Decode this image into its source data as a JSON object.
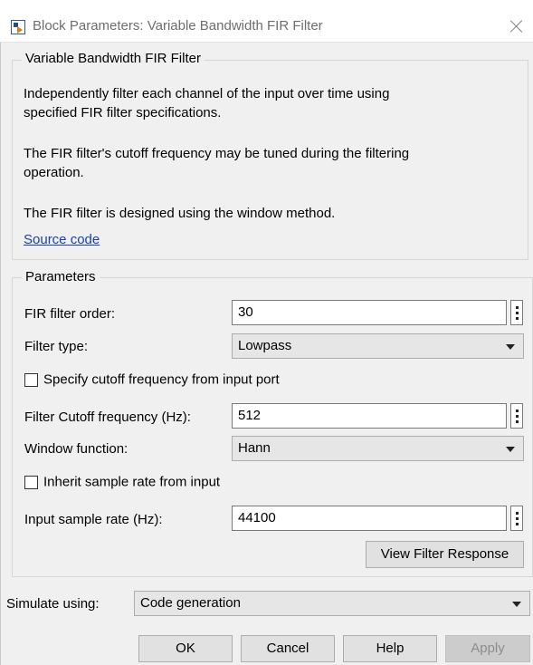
{
  "window": {
    "title": "Block Parameters: Variable Bandwidth FIR Filter",
    "icon": "simulink-block-icon",
    "close_icon": "close-icon"
  },
  "description": {
    "group_title": "Variable Bandwidth FIR Filter",
    "line1": "Independently filter each channel of the input over time using",
    "line2": "specified FIR filter specifications.",
    "line3": "The FIR filter's cutoff frequency may be tuned during the filtering",
    "line4": "operation.",
    "line5": "The FIR filter is designed using the window method.",
    "link": "Source code"
  },
  "parameters": {
    "group_title": "Parameters",
    "filter_order": {
      "label": "FIR filter order:",
      "value": "30"
    },
    "filter_type": {
      "label": "Filter type:",
      "value": "Lowpass"
    },
    "cutoff_from_port": {
      "label": "Specify cutoff frequency from input port",
      "checked": false
    },
    "cutoff_freq": {
      "label": "Filter Cutoff frequency (Hz):",
      "value": "512"
    },
    "window_function": {
      "label": "Window function:",
      "value": "Hann"
    },
    "inherit_rate": {
      "label": "Inherit sample rate from input",
      "checked": false
    },
    "sample_rate": {
      "label": "Input sample rate (Hz):",
      "value": "44100"
    },
    "view_response_button": "View Filter Response"
  },
  "simulate": {
    "label": "Simulate using:",
    "value": "Code generation"
  },
  "buttons": {
    "ok": "OK",
    "cancel": "Cancel",
    "help": "Help",
    "apply": "Apply"
  }
}
